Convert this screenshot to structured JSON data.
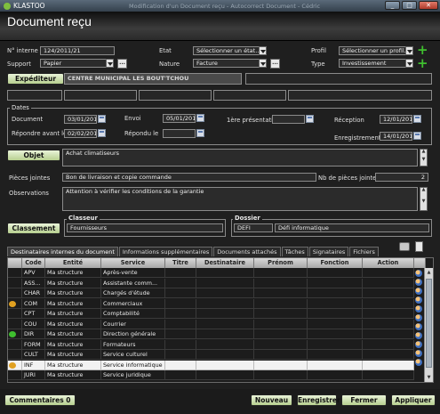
{
  "window": {
    "app_title": "KLASTOO",
    "ghost_title": "Modification d'un Document reçu - Autocorrect Document - Cédric"
  },
  "header": {
    "title": "Document reçu"
  },
  "general": {
    "numero_label": "N° interne",
    "numero_value": "124/2011/21",
    "etat_label": "Etat",
    "etat_value": "Sélectionner un état...",
    "profil_label": "Profil",
    "profil_value": "Sélectionner un profil...",
    "support_label": "Support",
    "support_value": "Papier",
    "nature_label": "Nature",
    "nature_value": "Facture",
    "type_label": "Type",
    "type_value": "Investissement"
  },
  "expediteur": {
    "button_label": "Expéditeur",
    "name": "CENTRE MUNICIPAL LES BOUT'TCHOU"
  },
  "dates": {
    "group_label": "Dates",
    "document_label": "Document",
    "document_value": "03/01/2011",
    "envoi_label": "Envoi",
    "envoi_value": "05/01/2011",
    "premiere_label": "1ère présentation",
    "premiere_value": "",
    "reception_label": "Réception",
    "reception_value": "12/01/2011",
    "repondre_label": "Répondre avant le",
    "repondre_value": "02/02/2011",
    "repondu_label": "Répondu le",
    "repondu_value": "",
    "enregistrement_label": "Enregistrement",
    "enregistrement_value": "14/01/2011"
  },
  "objet": {
    "button_label": "Objet",
    "value": "Achat climatiseurs"
  },
  "pieces": {
    "label": "Pièces jointes",
    "value": "Bon de livraison et copie commande",
    "nb_label": "Nb de pièces jointes",
    "nb_value": "2"
  },
  "observations": {
    "label": "Observations",
    "value": "Attention à vérifier les conditions de la garantie"
  },
  "classement": {
    "button_label": "Classement",
    "classeur_label": "Classeur",
    "classeur_value": "Fournisseurs",
    "dossier_label": "Dossier",
    "dossier_code": "DEFI",
    "dossier_value": "Défi informatique"
  },
  "tabs": [
    {
      "label": "Destinataires internes du document",
      "active": true
    },
    {
      "label": "Informations supplémentaires",
      "active": false
    },
    {
      "label": "Documents attachés",
      "active": false
    },
    {
      "label": "Tâches",
      "active": false
    },
    {
      "label": "Signataires",
      "active": false
    },
    {
      "label": "Fichiers",
      "active": false
    }
  ],
  "table": {
    "columns": [
      "Code",
      "Entité",
      "Service",
      "Titre",
      "Destinataire",
      "Prénom",
      "Fonction",
      "Action"
    ],
    "rows": [
      {
        "icon": "",
        "code": "APV",
        "entite": "Ma structure",
        "service": "Après-vente"
      },
      {
        "icon": "",
        "code": "ASS...",
        "entite": "Ma structure",
        "service": "Assistante comm..."
      },
      {
        "icon": "",
        "code": "CHAR",
        "entite": "Ma structure",
        "service": "Chargés d'étude"
      },
      {
        "icon": "C",
        "code": "COM",
        "entite": "Ma structure",
        "service": "Commerciaux"
      },
      {
        "icon": "",
        "code": "CPT",
        "entite": "Ma structure",
        "service": "Comptabilité"
      },
      {
        "icon": "",
        "code": "COU",
        "entite": "Ma structure",
        "service": "Courrier"
      },
      {
        "icon": "D",
        "code": "DIR",
        "entite": "Ma structure",
        "service": "Direction générale"
      },
      {
        "icon": "",
        "code": "FORM",
        "entite": "Ma structure",
        "service": "Formateurs"
      },
      {
        "icon": "",
        "code": "CULT",
        "entite": "Ma structure",
        "service": "Service culturel"
      },
      {
        "icon": "CC",
        "code": "INF",
        "entite": "Ma structure",
        "service": "Service informatique",
        "selected": true
      },
      {
        "icon": "",
        "code": "JURI",
        "entite": "Ma structure",
        "service": "Service juridique"
      }
    ]
  },
  "footer": {
    "commentaires": "Commentaires 0",
    "nouveau": "Nouveau",
    "enregistrer": "Enregistrer",
    "fermer": "Fermer",
    "appliquer": "Appliquer"
  }
}
